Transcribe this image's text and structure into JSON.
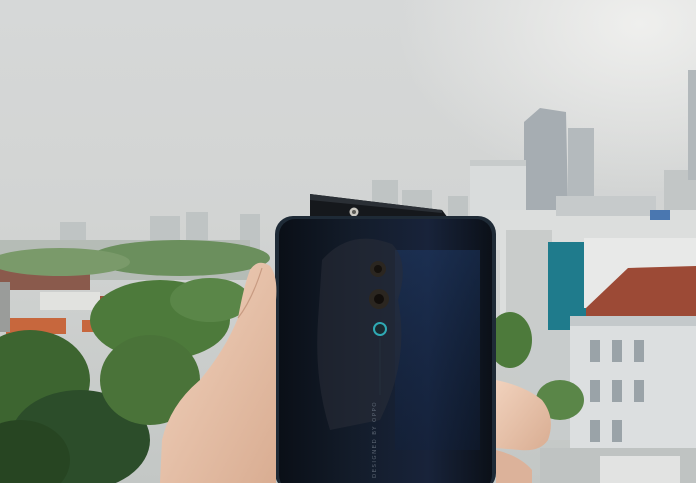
{
  "photo": {
    "subject": "smartphone-with-popup-camera-held-in-hand",
    "back_text": "DESIGNED BY OPPO",
    "colors": {
      "sky": "#d2d4d4",
      "haze": "#c4c8c8",
      "phone_body": "#0e1520",
      "phone_edge": "#1e2a36",
      "popup_module": "#15181c",
      "skin": "#e9c4ad",
      "tree_dark": "#2c4d2a",
      "tree_mid": "#4d7a3b",
      "roof_red": "#9c4a36",
      "teal_wall": "#1f7b8c",
      "building_white": "#e6e7e6"
    }
  }
}
